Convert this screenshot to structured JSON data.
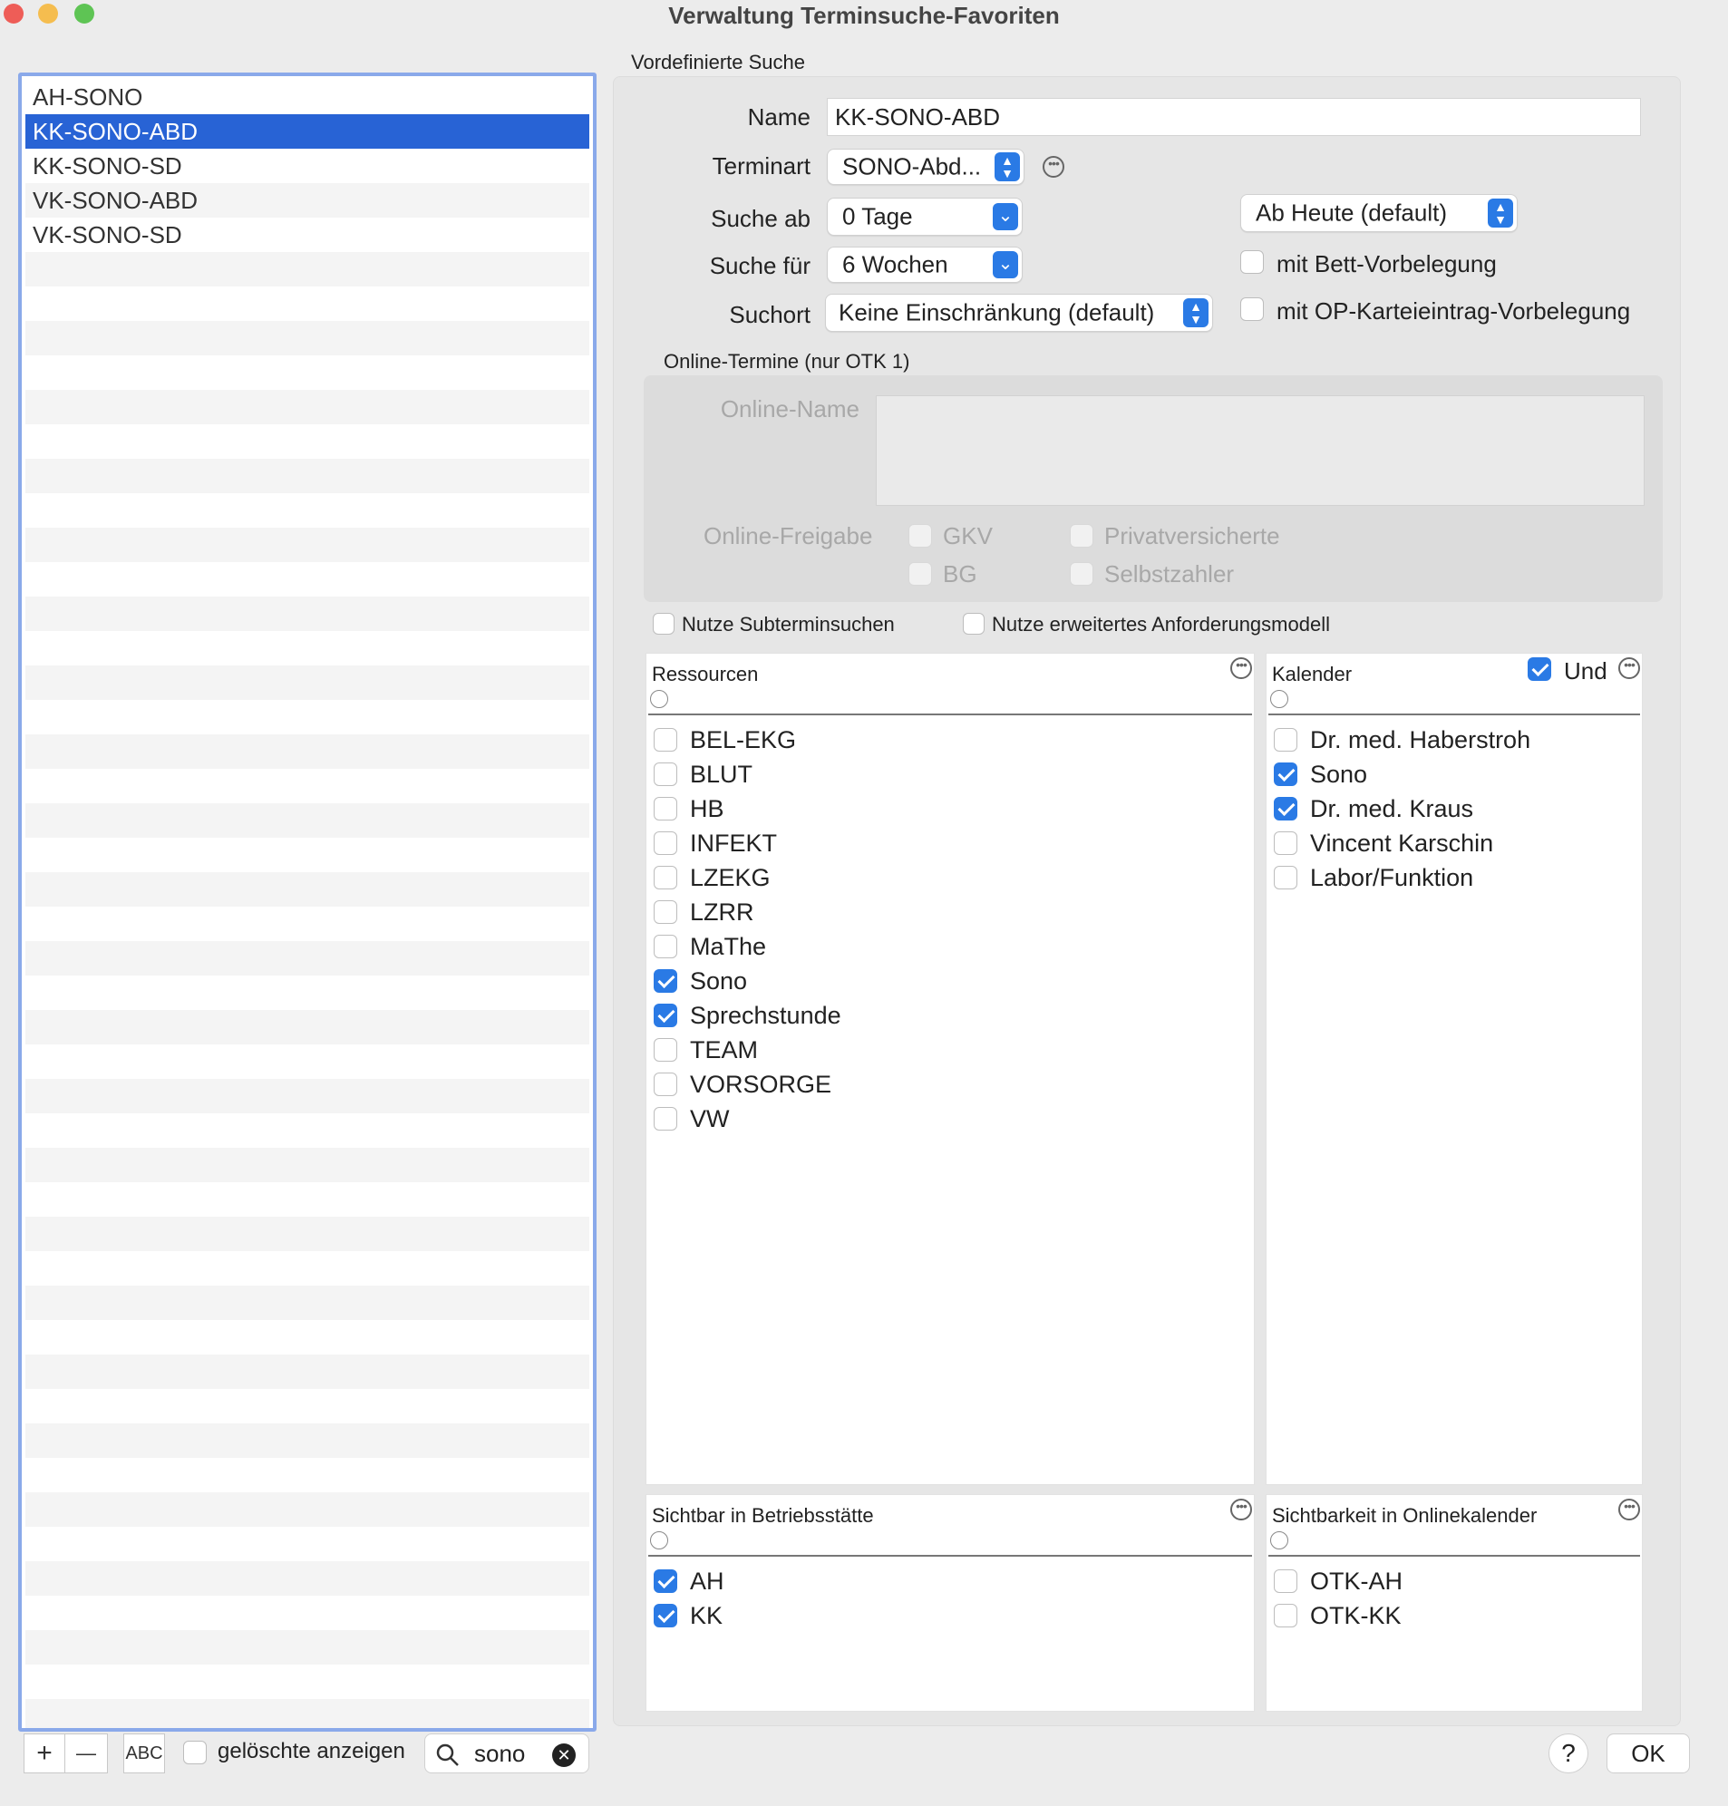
{
  "window": {
    "title": "Verwaltung Terminsuche-Favoriten"
  },
  "left_list": {
    "items": [
      "AH-SONO",
      "KK-SONO-ABD",
      "KK-SONO-SD",
      "VK-SONO-ABD",
      "VK-SONO-SD"
    ],
    "selected_index": 1
  },
  "bottom_bar": {
    "add_label": "+",
    "remove_label": "—",
    "abc_label": "ABC",
    "show_deleted_label": "gelöschte anzeigen",
    "search_value": "sono"
  },
  "section_title": "Vordefinierte Suche",
  "form": {
    "name_label": "Name",
    "name_value": "KK-SONO-ABD",
    "terminart_label": "Terminart",
    "terminart_value": "SONO-Abd...",
    "suche_ab_label": "Suche ab",
    "suche_ab_value": "0 Tage",
    "ab_heute_value": "Ab Heute (default)",
    "suche_fuer_label": "Suche für",
    "suche_fuer_value": "6 Wochen",
    "bett_label": "mit Bett-Vorbelegung",
    "suchort_label": "Suchort",
    "suchort_value": "Keine Einschränkung (default)",
    "op_label": "mit OP-Karteieintrag-Vorbelegung"
  },
  "online": {
    "section_title": "Online-Termine (nur OTK 1)",
    "name_label": "Online-Name",
    "freigabe_label": "Online-Freigabe",
    "gkv": "GKV",
    "privat": "Privatversicherte",
    "bg": "BG",
    "selbst": "Selbstzahler"
  },
  "options": {
    "subtermin": "Nutze Subterminsuchen",
    "anforderung": "Nutze erweitertes Anforderungsmodell"
  },
  "ressourcen": {
    "title": "Ressourcen",
    "items": [
      {
        "label": "BEL-EKG",
        "checked": false
      },
      {
        "label": "BLUT",
        "checked": false
      },
      {
        "label": "HB",
        "checked": false
      },
      {
        "label": "INFEKT",
        "checked": false
      },
      {
        "label": "LZEKG",
        "checked": false
      },
      {
        "label": "LZRR",
        "checked": false
      },
      {
        "label": "MaThe",
        "checked": false
      },
      {
        "label": "Sono",
        "checked": true
      },
      {
        "label": "Sprechstunde",
        "checked": true
      },
      {
        "label": "TEAM",
        "checked": false
      },
      {
        "label": "VORSORGE",
        "checked": false
      },
      {
        "label": "VW",
        "checked": false
      }
    ]
  },
  "kalender": {
    "title": "Kalender",
    "und_label": "Und",
    "items": [
      {
        "label": "Dr. med. Haberstroh",
        "checked": false
      },
      {
        "label": "Sono",
        "checked": true
      },
      {
        "label": "Dr. med. Kraus",
        "checked": true
      },
      {
        "label": "Vincent Karschin",
        "checked": false
      },
      {
        "label": "Labor/Funktion",
        "checked": false
      }
    ]
  },
  "betriebsstaette": {
    "title": "Sichtbar in Betriebsstätte",
    "items": [
      {
        "label": "AH",
        "checked": true
      },
      {
        "label": "KK",
        "checked": true
      }
    ]
  },
  "onlinekalender": {
    "title": "Sichtbarkeit in Onlinekalender",
    "items": [
      {
        "label": "OTK-AH",
        "checked": false
      },
      {
        "label": "OTK-KK",
        "checked": false
      }
    ]
  },
  "footer": {
    "help_label": "?",
    "ok_label": "OK"
  },
  "colors": {
    "accent": "#2a7ae5",
    "selection": "#2863d5",
    "list_border": "#8aa9ea"
  }
}
